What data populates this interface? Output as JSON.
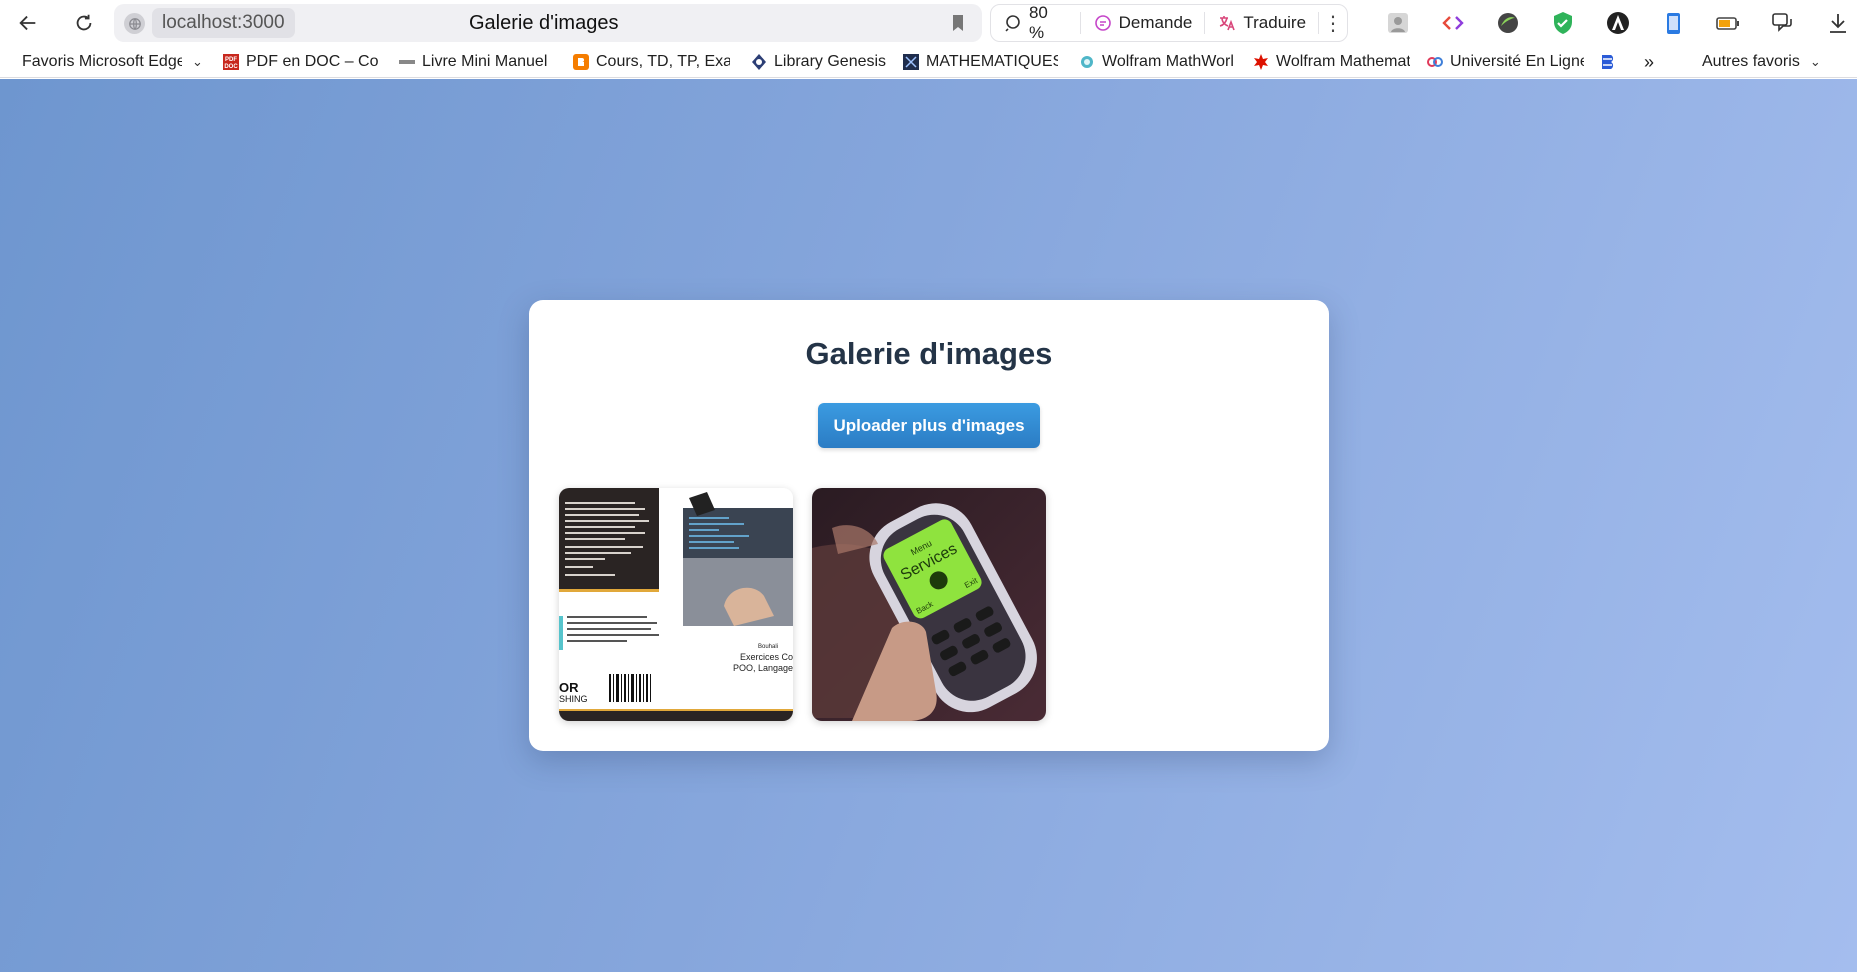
{
  "browser": {
    "url": "localhost:3000",
    "tab_title": "Galerie d'images",
    "zoom": "80 %",
    "ask_label": "Demande",
    "translate_label": "Traduire"
  },
  "bookmarks": {
    "items": [
      {
        "label": "Favoris Microsoft Edge",
        "icon": "folder-icon"
      },
      {
        "label": "PDF en DOC – Conv",
        "icon": "pdf-doc-icon"
      },
      {
        "label": "Livre Mini Manuel",
        "icon": "book-icon"
      },
      {
        "label": "Cours, TD, TP, Exa",
        "icon": "blogger-icon"
      },
      {
        "label": "Library Genesis",
        "icon": "libgen-icon"
      },
      {
        "label": "MATHEMATIQUES",
        "icon": "math-icon"
      },
      {
        "label": "Wolfram MathWorld",
        "icon": "mathworld-icon"
      },
      {
        "label": "Wolfram Mathematica",
        "icon": "wolfram-icon"
      },
      {
        "label": "Université En Ligne",
        "icon": "uel-icon"
      }
    ],
    "more": "»",
    "other_favorites": "Autres favoris"
  },
  "page": {
    "title": "Galerie d'images",
    "upload_button": "Uploader plus d'images",
    "images": [
      {
        "alt": "book-cover-image",
        "caption_lines": [
          "Exercices Co",
          "POO, Langage"
        ],
        "logo_text": "OR",
        "logo_sub": "SHING"
      },
      {
        "alt": "nokia-phone-image",
        "screen_text": [
          "Menu",
          "Services",
          "Back",
          "Exit"
        ]
      }
    ]
  },
  "colors": {
    "background_from": "#6e96cf",
    "background_to": "#a4bdee",
    "button": "#2f88cf",
    "title": "#243447"
  }
}
